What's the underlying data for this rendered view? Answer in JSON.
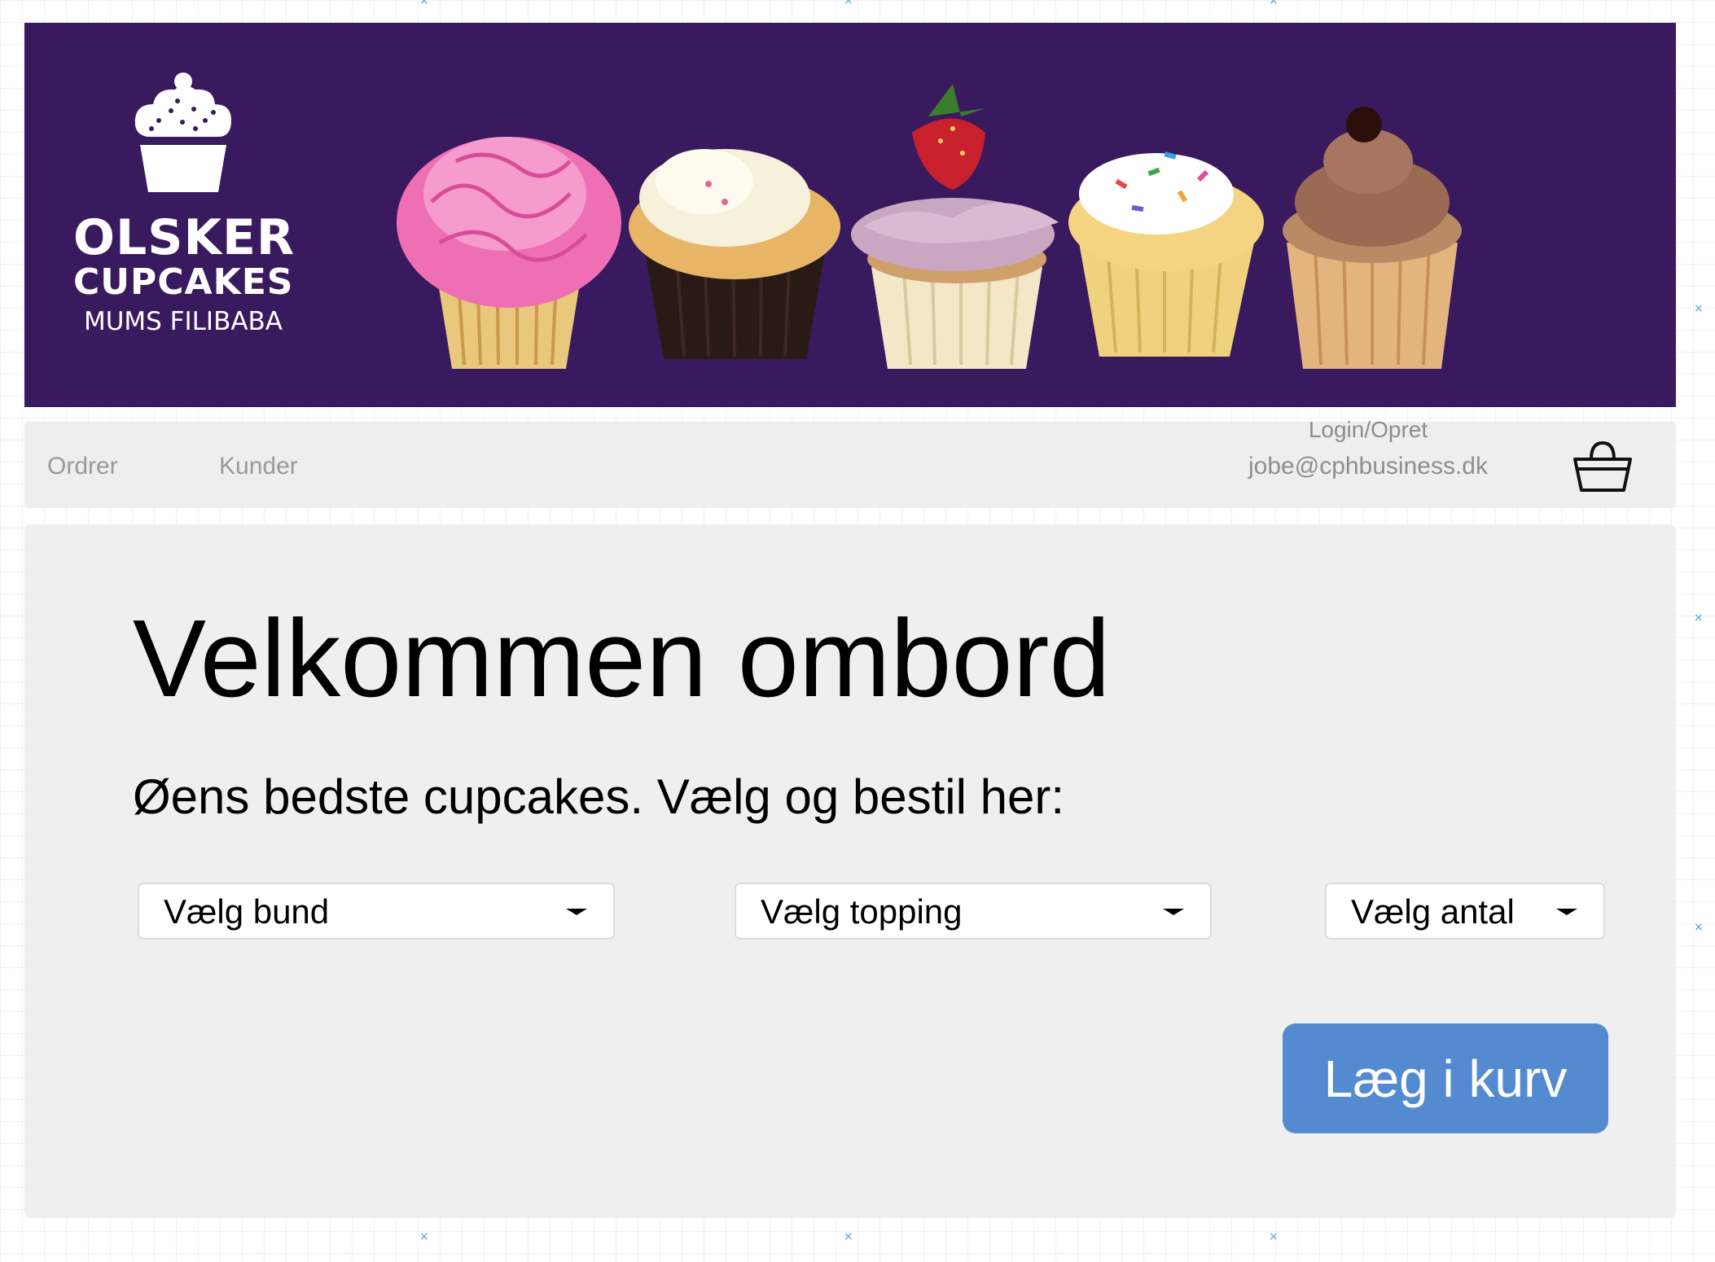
{
  "banner": {
    "logo": {
      "line1": "OLSKER",
      "line2": "CUPCAKES",
      "line3": "MUMS FILIBABA"
    },
    "background_color": "#3a1a5e",
    "images": [
      "pink-frosting-cupcake",
      "cream-chocolate-cupcake",
      "strawberry-cupcake",
      "sprinkles-cupcake",
      "chocolate-cupcake"
    ]
  },
  "nav": {
    "orders": "Ordrer",
    "customers": "Kunder",
    "login": "Login/Opret",
    "email": "jobe@cphbusiness.dk",
    "basket_icon": "basket-icon"
  },
  "main": {
    "title": "Velkommen ombord",
    "subtitle": "Øens bedste cupcakes. Vælg og bestil her:",
    "dropdowns": {
      "bund": "Vælg bund",
      "topping": "Vælg topping",
      "antal": "Vælg antal"
    },
    "cart_button": "Læg i kurv",
    "accent_color": "#548bd0"
  }
}
